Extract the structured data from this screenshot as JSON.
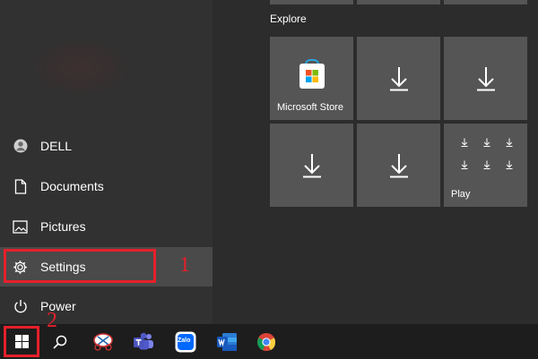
{
  "start_menu": {
    "left_items": [
      {
        "label": "DELL",
        "icon": "user-icon"
      },
      {
        "label": "Documents",
        "icon": "document-icon"
      },
      {
        "label": "Pictures",
        "icon": "picture-icon"
      },
      {
        "label": "Settings",
        "icon": "gear-icon"
      },
      {
        "label": "Power",
        "icon": "power-icon"
      }
    ],
    "section_title": "Explore",
    "tiles": [
      {
        "label": "Microsoft Store",
        "icon": "store-icon"
      },
      {
        "label": "",
        "icon": "download-icon"
      },
      {
        "label": "",
        "icon": "download-icon"
      },
      {
        "label": "",
        "icon": "download-icon"
      },
      {
        "label": "",
        "icon": "download-icon"
      },
      {
        "label": "Play",
        "icon": "download-grid-icon"
      }
    ]
  },
  "annotations": {
    "step1": "1",
    "step2": "2",
    "color": "#e5202a"
  },
  "taskbar": {
    "icons": [
      "windows-start-icon",
      "search-icon",
      "snipping-tool-icon",
      "teams-icon",
      "zalo-icon",
      "word-icon",
      "chrome-icon"
    ],
    "zalo_label": "Zalo"
  },
  "colors": {
    "tile_bg": "#555555",
    "highlight_bg": "#4a4a4a",
    "accent_red": "#e5202a"
  }
}
